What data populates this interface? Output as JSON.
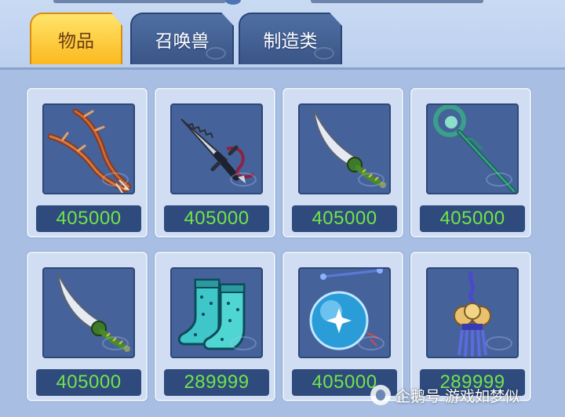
{
  "tabs": [
    {
      "label": "物品",
      "active": true
    },
    {
      "label": "召唤兽",
      "active": false
    },
    {
      "label": "制造类",
      "active": false
    }
  ],
  "items": [
    {
      "icon": "claw-weapon-icon",
      "price": "405000"
    },
    {
      "icon": "serrated-sword-icon",
      "price": "405000"
    },
    {
      "icon": "curved-blade-icon",
      "price": "405000"
    },
    {
      "icon": "jade-staff-icon",
      "price": "405000"
    },
    {
      "icon": "curved-blade-icon",
      "price": "405000"
    },
    {
      "icon": "boots-icon",
      "price": "289999"
    },
    {
      "icon": "crystal-orb-icon",
      "price": "405000"
    },
    {
      "icon": "bell-tassel-icon",
      "price": "289999"
    }
  ],
  "watermark": {
    "text": "企鹅号 游戏如梦似"
  },
  "colors": {
    "price_text": "#6fe54b",
    "active_tab": "#fbb91f",
    "inactive_tab": "#3a5586"
  }
}
